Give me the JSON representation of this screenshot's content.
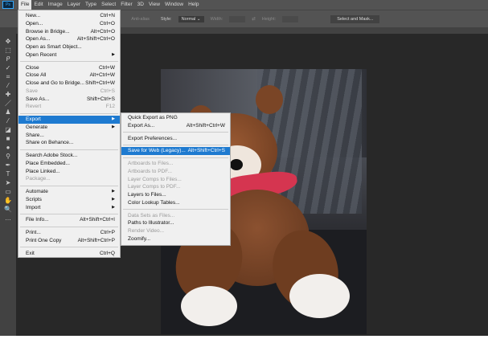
{
  "menubar": {
    "logo": "Ps",
    "items": [
      "File",
      "Edit",
      "Image",
      "Layer",
      "Type",
      "Select",
      "Filter",
      "3D",
      "View",
      "Window",
      "Help"
    ]
  },
  "options": {
    "anti_alias": "Anti-alias",
    "style_label": "Style:",
    "style_value": "Normal",
    "width_label": "Width:",
    "height_label": "Height:",
    "select_mask": "Select and Mask..."
  },
  "toolbar": {
    "icons": [
      "move-icon",
      "marquee-icon",
      "lasso-icon",
      "quick-select-icon",
      "crop-icon",
      "eyedropper-icon",
      "healing-icon",
      "brush-icon",
      "stamp-icon",
      "history-brush-icon",
      "eraser-icon",
      "gradient-icon",
      "blur-icon",
      "dodge-icon",
      "pen-icon",
      "type-icon",
      "path-select-icon",
      "rectangle-icon",
      "hand-icon",
      "zoom-icon",
      "more-icon"
    ],
    "glyphs": [
      "✥",
      "⬚",
      "ᑭ",
      "✓",
      "⌗",
      "⁄",
      "✚",
      "／",
      "♟",
      "⁄",
      "◪",
      "■",
      "●",
      "⚲",
      "✒",
      "T",
      "➤",
      "▭",
      "✋",
      "🔍",
      "…"
    ]
  },
  "file_menu": [
    [
      {
        "label": "New...",
        "shortcut": "Ctrl+N"
      },
      {
        "label": "Open...",
        "shortcut": "Ctrl+O"
      },
      {
        "label": "Browse in Bridge...",
        "shortcut": "Alt+Ctrl+O"
      },
      {
        "label": "Open As...",
        "shortcut": "Alt+Shift+Ctrl+O"
      },
      {
        "label": "Open as Smart Object...",
        "shortcut": ""
      },
      {
        "label": "Open Recent",
        "shortcut": "",
        "submenu": true
      }
    ],
    [
      {
        "label": "Close",
        "shortcut": "Ctrl+W"
      },
      {
        "label": "Close All",
        "shortcut": "Alt+Ctrl+W"
      },
      {
        "label": "Close and Go to Bridge...",
        "shortcut": "Shift+Ctrl+W"
      },
      {
        "label": "Save",
        "shortcut": "Ctrl+S",
        "disabled": true
      },
      {
        "label": "Save As...",
        "shortcut": "Shift+Ctrl+S"
      },
      {
        "label": "Revert",
        "shortcut": "F12",
        "disabled": true
      }
    ],
    [
      {
        "label": "Export",
        "shortcut": "",
        "submenu": true,
        "highlighted": true
      },
      {
        "label": "Generate",
        "shortcut": "",
        "submenu": true
      },
      {
        "label": "Share...",
        "shortcut": ""
      },
      {
        "label": "Share on Behance...",
        "shortcut": ""
      }
    ],
    [
      {
        "label": "Search Adobe Stock...",
        "shortcut": ""
      },
      {
        "label": "Place Embedded...",
        "shortcut": ""
      },
      {
        "label": "Place Linked...",
        "shortcut": ""
      },
      {
        "label": "Package...",
        "shortcut": "",
        "disabled": true
      }
    ],
    [
      {
        "label": "Automate",
        "shortcut": "",
        "submenu": true
      },
      {
        "label": "Scripts",
        "shortcut": "",
        "submenu": true
      },
      {
        "label": "Import",
        "shortcut": "",
        "submenu": true
      }
    ],
    [
      {
        "label": "File Info...",
        "shortcut": "Alt+Shift+Ctrl+I"
      }
    ],
    [
      {
        "label": "Print...",
        "shortcut": "Ctrl+P"
      },
      {
        "label": "Print One Copy",
        "shortcut": "Alt+Shift+Ctrl+P"
      }
    ],
    [
      {
        "label": "Exit",
        "shortcut": "Ctrl+Q"
      }
    ]
  ],
  "export_menu": [
    [
      {
        "label": "Quick Export as PNG",
        "shortcut": ""
      },
      {
        "label": "Export As...",
        "shortcut": "Alt+Shift+Ctrl+W"
      }
    ],
    [
      {
        "label": "Export Preferences...",
        "shortcut": ""
      }
    ],
    [
      {
        "label": "Save for Web (Legacy)...",
        "shortcut": "Alt+Shift+Ctrl+S",
        "highlighted": true
      }
    ],
    [
      {
        "label": "Artboards to Files...",
        "shortcut": "",
        "disabled": true
      },
      {
        "label": "Artboards to PDF...",
        "shortcut": "",
        "disabled": true
      },
      {
        "label": "Layer Comps to Files...",
        "shortcut": "",
        "disabled": true
      },
      {
        "label": "Layer Comps to PDF...",
        "shortcut": "",
        "disabled": true
      },
      {
        "label": "Layers to Files...",
        "shortcut": ""
      },
      {
        "label": "Color Lookup Tables...",
        "shortcut": ""
      }
    ],
    [
      {
        "label": "Data Sets as Files...",
        "shortcut": "",
        "disabled": true
      },
      {
        "label": "Paths to Illustrator...",
        "shortcut": ""
      },
      {
        "label": "Render Video...",
        "shortcut": "",
        "disabled": true
      },
      {
        "label": "Zoomify...",
        "shortcut": ""
      }
    ]
  ],
  "colors": {
    "accent": "#1e7ad0",
    "ui_dark": "#535353",
    "canvas": "#282828"
  }
}
